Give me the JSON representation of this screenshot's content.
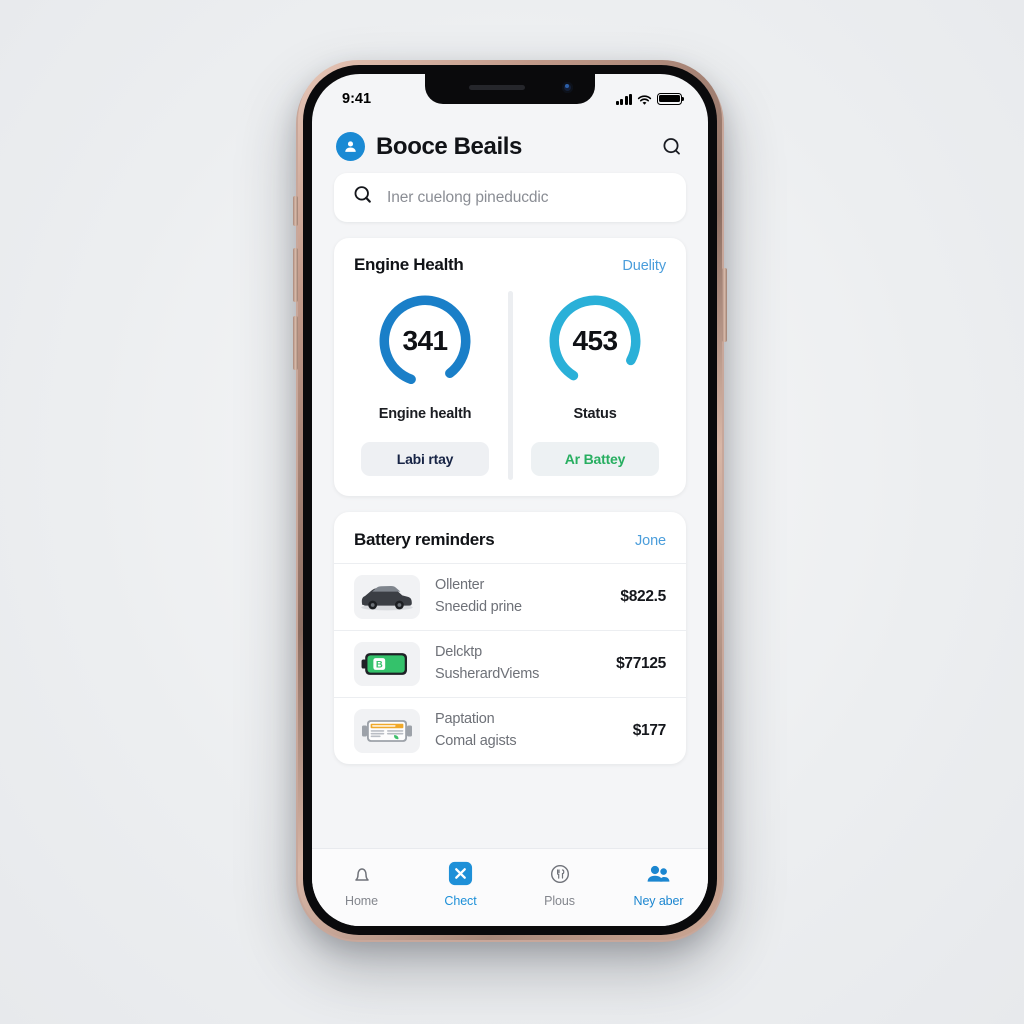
{
  "status_bar": {
    "time": "9:41",
    "icons": [
      "signal-bars-icon",
      "wifi-icon",
      "battery-icon"
    ]
  },
  "header": {
    "avatar_icon": "person-avatar-icon",
    "title": "Booce Beails",
    "search_icon": "search-icon"
  },
  "search": {
    "icon": "search-icon",
    "placeholder": "Iner cuelong pineducdic",
    "value": ""
  },
  "engine_card": {
    "title": "Engine Health",
    "link": "Duelity",
    "gauges": [
      {
        "value": "341",
        "label": "Engine health",
        "button": "Labi rtay",
        "color": "#1a7fc8",
        "percent": 84,
        "button_style": "navy"
      },
      {
        "value": "453",
        "label": "Status",
        "button": "Ar Battey",
        "color": "#2ab0d8",
        "percent": 74,
        "button_style": "green"
      }
    ]
  },
  "reminders_card": {
    "title": "Battery reminders",
    "link": "Jone",
    "rows": [
      {
        "icon": "car-thumbnail-icon",
        "line1": "Ollenter",
        "line2": "Sneedid prine",
        "price": "$822.5"
      },
      {
        "icon": "battery-green-icon",
        "line1": "Delcktp",
        "line2": "SusherardViems",
        "price": "$77125"
      },
      {
        "icon": "newspaper-icon",
        "line1": "Paptation",
        "line2": "Comal agists",
        "price": "$177"
      }
    ]
  },
  "tabbar": {
    "tabs": [
      {
        "label": "Home",
        "icon": "bell-icon",
        "state": "inactive"
      },
      {
        "label": "Chect",
        "icon": "close-square-icon",
        "state": "active"
      },
      {
        "label": "Plous",
        "icon": "tools-circle-icon",
        "state": "inactive"
      },
      {
        "label": "Ney aber",
        "icon": "people-icon",
        "state": "accent"
      }
    ]
  },
  "colors": {
    "accent_blue": "#1a8ad4",
    "gauge_blue": "#1a7fc8",
    "gauge_cyan": "#2ab0d8",
    "green": "#27ae60",
    "link_blue": "#4a9ddb"
  }
}
